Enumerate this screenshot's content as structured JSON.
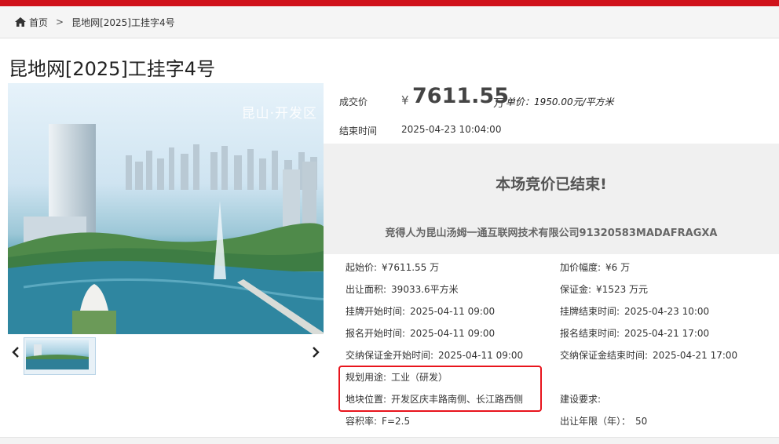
{
  "breadcrumb": {
    "home": "首页",
    "separator": ">",
    "current": "昆地网[2025]工挂字4号"
  },
  "page_title": "昆地网[2025]工挂字4号",
  "image": {
    "watermark": "昆山·开发区"
  },
  "price": {
    "label": "成交价",
    "currency": "¥",
    "value": "7611.55",
    "unit": "万",
    "unit_price": "单价：1950.00元/平方米"
  },
  "end_time": {
    "label": "结束时间",
    "value": "2025-04-23 10:04:00"
  },
  "result": {
    "title": "本场竞价已结束!",
    "winner": "竞得人为昆山汤姆一通互联网技术有限公司91320583MADAFRAGXA"
  },
  "details": {
    "start_price": {
      "label": "起始价:",
      "value": "¥7611.55 万"
    },
    "increment": {
      "label": "加价幅度:",
      "value": "¥6 万"
    },
    "area": {
      "label": "出让面积:",
      "value": "39033.6平方米"
    },
    "deposit": {
      "label": "保证金:",
      "value": "¥1523 万元"
    },
    "listing_start": {
      "label": "挂牌开始时间:",
      "value": "2025-04-11 09:00"
    },
    "listing_end": {
      "label": "挂牌结束时间:",
      "value": "2025-04-23 10:00"
    },
    "signup_start": {
      "label": "报名开始时间:",
      "value": "2025-04-11 09:00"
    },
    "signup_end": {
      "label": "报名结束时间:",
      "value": "2025-04-21 17:00"
    },
    "deposit_start": {
      "label": "交纳保证金开始时间:",
      "value": "2025-04-11 09:00"
    },
    "deposit_end": {
      "label": "交纳保证金结束时间:",
      "value": "2025-04-21 17:00"
    },
    "use": {
      "label": "规划用途:",
      "value": "工业（研发）"
    },
    "location": {
      "label": "地块位置:",
      "value": "开发区庆丰路南侧、长江路西侧"
    },
    "requirements": {
      "label": "建设要求:",
      "value": ""
    },
    "far": {
      "label": "容积率:",
      "value": "F=2.5"
    },
    "term": {
      "label": "出让年限（年）：",
      "value": "50"
    }
  },
  "colors": {
    "brand_red": "#d0121b",
    "highlight": "#e8141c"
  }
}
